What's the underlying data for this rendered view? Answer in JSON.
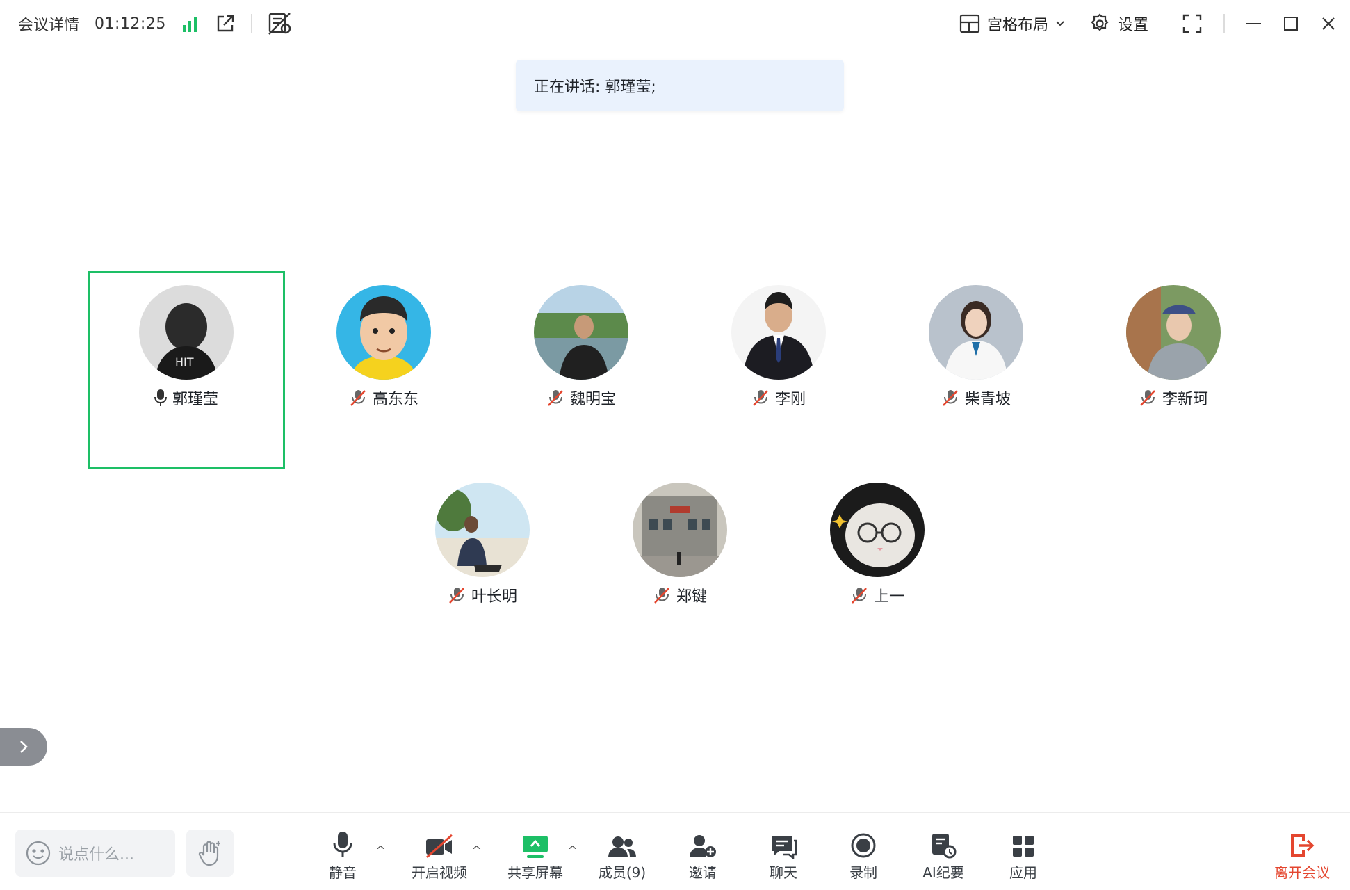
{
  "topbar": {
    "title": "会议详情",
    "timer": "01:12:25",
    "layout_label": "宫格布局",
    "settings_label": "设置",
    "accent": "#1dbf66"
  },
  "banner": {
    "speaking_text": "正在讲话: 郭瑾莹;"
  },
  "participants": [
    {
      "name": "郭瑾莹",
      "mic": "on",
      "speaking": true
    },
    {
      "name": "高东东",
      "mic": "muted"
    },
    {
      "name": "魏明宝",
      "mic": "muted"
    },
    {
      "name": "李刚",
      "mic": "muted"
    },
    {
      "name": "柴青坡",
      "mic": "muted"
    },
    {
      "name": "李新珂",
      "mic": "muted"
    },
    {
      "name": "叶长明",
      "mic": "muted"
    },
    {
      "name": "郑键",
      "mic": "muted"
    },
    {
      "name": "上一",
      "mic": "muted"
    }
  ],
  "bottombar": {
    "chat_placeholder": "说点什么...",
    "tools": {
      "mute": "静音",
      "video": "开启视频",
      "share": "共享屏幕",
      "members": "成员(9)",
      "invite": "邀请",
      "chat": "聊天",
      "record": "录制",
      "ai_notes": "AI纪要",
      "apps": "应用",
      "leave": "离开会议"
    },
    "leave_color": "#e4462f"
  }
}
